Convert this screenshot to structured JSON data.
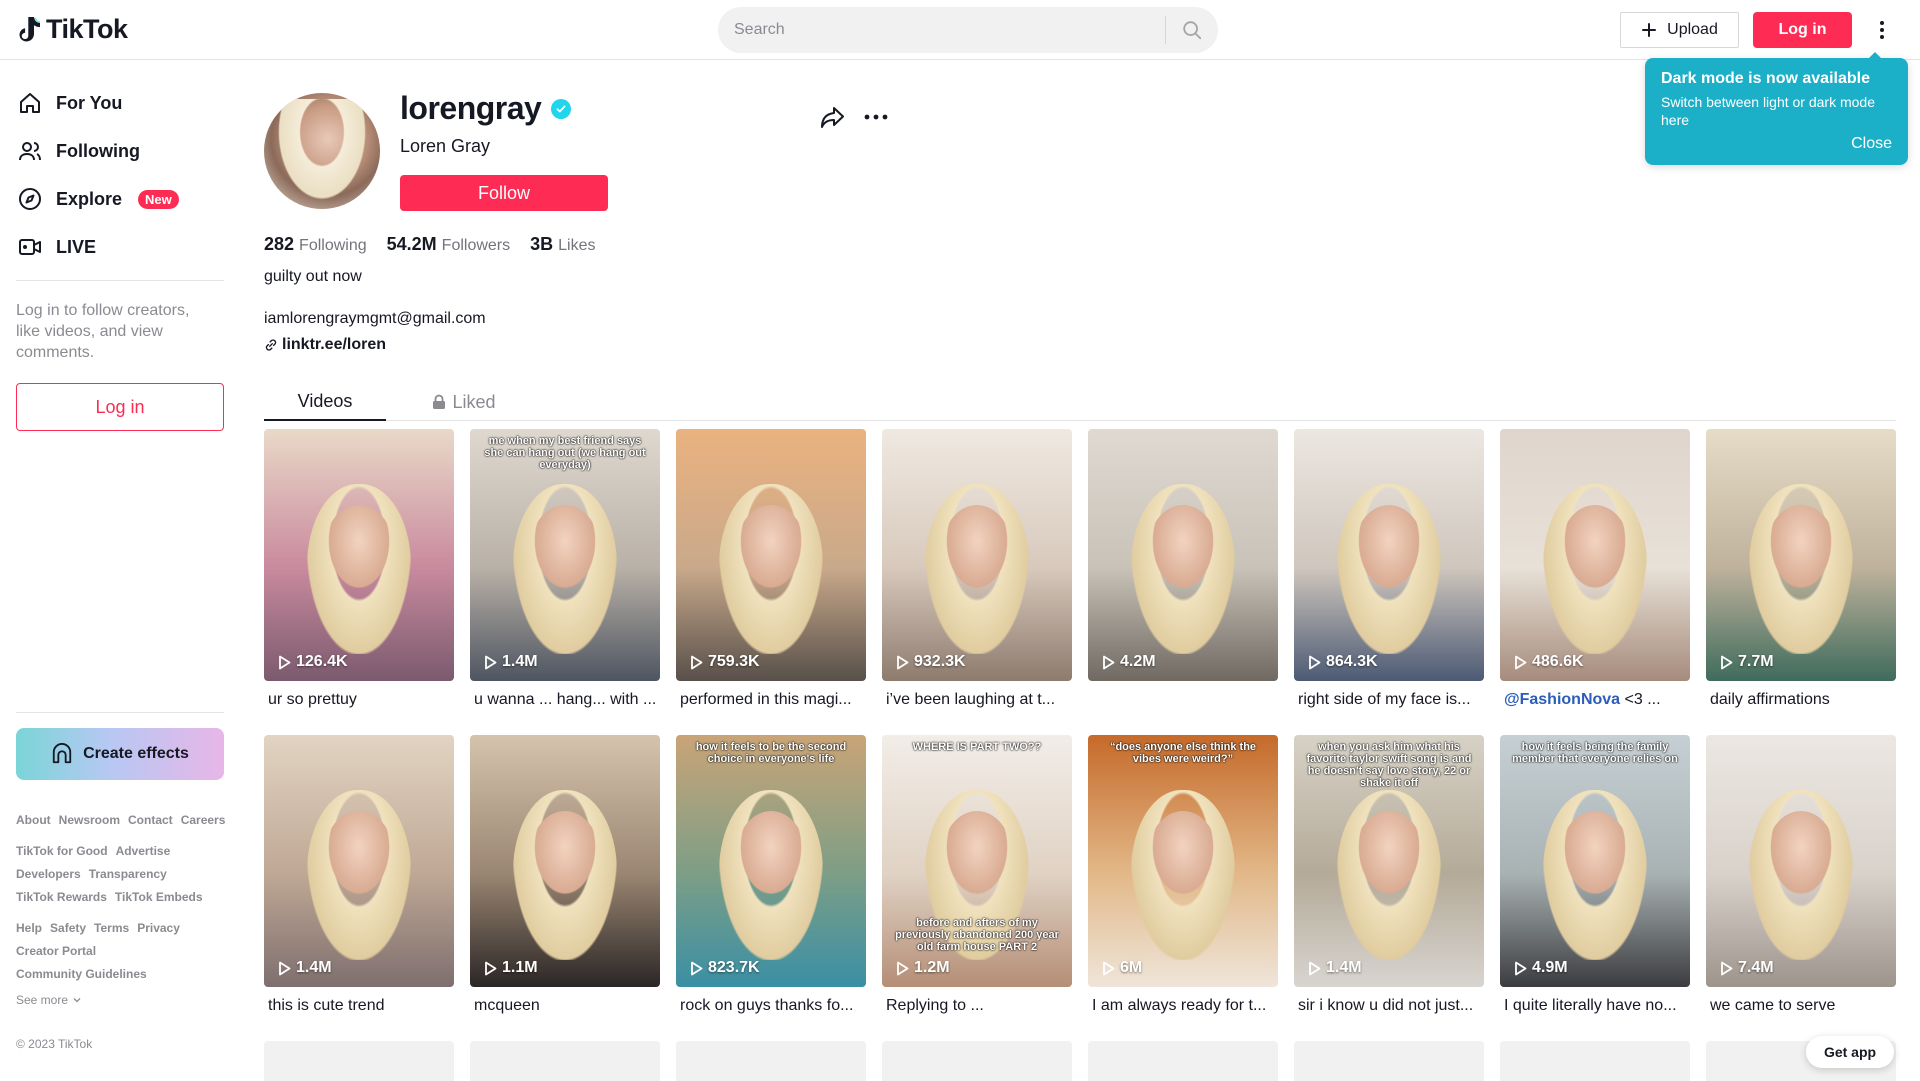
{
  "header": {
    "logo_text": "TikTok",
    "search_placeholder": "Search",
    "upload_label": "Upload",
    "login_label": "Log in"
  },
  "tooltip": {
    "title": "Dark mode is now available",
    "description": "Switch between light or dark mode here",
    "close_label": "Close"
  },
  "sidebar": {
    "nav": [
      {
        "label": "For You",
        "icon": "home-icon"
      },
      {
        "label": "Following",
        "icon": "following-icon"
      },
      {
        "label": "Explore",
        "icon": "compass-icon",
        "badge": "New"
      },
      {
        "label": "LIVE",
        "icon": "live-icon"
      }
    ],
    "login_prompt": "Log in to follow creators, like videos, and view comments.",
    "login_button": "Log in",
    "create_effects": "Create effects",
    "footer_rows": [
      [
        "About",
        "Newsroom",
        "Contact",
        "Careers"
      ],
      [
        "TikTok for Good",
        "Advertise"
      ],
      [
        "Developers",
        "Transparency"
      ],
      [
        "TikTok Rewards",
        "TikTok Embeds"
      ],
      [
        "Help",
        "Safety",
        "Terms",
        "Privacy"
      ],
      [
        "Creator Portal"
      ],
      [
        "Community Guidelines"
      ]
    ],
    "see_more": "See more",
    "copyright": "© 2023 TikTok"
  },
  "profile": {
    "username": "lorengray",
    "display_name": "Loren Gray",
    "follow_label": "Follow",
    "stats": {
      "following": {
        "value": "282",
        "label": "Following"
      },
      "followers": {
        "value": "54.2M",
        "label": "Followers"
      },
      "likes": {
        "value": "3B",
        "label": "Likes"
      }
    },
    "bio_line1": "guilty out now",
    "bio_line2": "iamlorengraymgmt@gmail.com",
    "link": "linktr.ee/loren"
  },
  "tabs": {
    "videos": "Videos",
    "liked": "Liked"
  },
  "videos": [
    {
      "views": "126.4K",
      "title": "ur so prettuy",
      "bg": [
        "#e9d9c8",
        "#c98a9e",
        "#7b5a6e"
      ],
      "overlay": ""
    },
    {
      "views": "1.4M",
      "title": "u wanna ... hang... with ...",
      "bg": [
        "#dfd8cf",
        "#b9b1a7",
        "#4e5561"
      ],
      "overlay": "me when my best friend says she can hang out (we hang out everyday)"
    },
    {
      "views": "759.3K",
      "title": "performed in this magi...",
      "bg": [
        "#eab27f",
        "#c9a98b",
        "#58504a"
      ],
      "overlay": ""
    },
    {
      "views": "932.3K",
      "title": "i’ve been laughing at t...",
      "bg": [
        "#efe9e1",
        "#d8c9bc",
        "#8d7b6e"
      ],
      "overlay": ""
    },
    {
      "views": "4.2M",
      "title": "",
      "bg": [
        "#dfd9d2",
        "#c9c2b8",
        "#6f6962"
      ],
      "overlay": ""
    },
    {
      "views": "864.3K",
      "title": "right side of my face is...",
      "bg": [
        "#ece7e1",
        "#cfc6bd",
        "#4c5a74"
      ],
      "overlay": ""
    },
    {
      "views": "486.6K",
      "title": "<3 ...",
      "mention": "@FashionNova",
      "bg": [
        "#dfd5cc",
        "#e8e1d8",
        "#a68b7c"
      ],
      "overlay": ""
    },
    {
      "views": "7.7M",
      "title": "daily affirmations",
      "bg": [
        "#e6dcc7",
        "#bfb29c",
        "#3f6b5c"
      ],
      "overlay": ""
    },
    {
      "views": "1.4M",
      "title": "this is cute trend",
      "bg": [
        "#e2d4c2",
        "#bfa895",
        "#7e6f6e"
      ],
      "overlay": ""
    },
    {
      "views": "1.1M",
      "title": "mcqueen",
      "bg": [
        "#d6c3ad",
        "#9a8672",
        "#2b2626"
      ],
      "overlay": ""
    },
    {
      "views": "823.7K",
      "title": "rock on guys thanks fo...",
      "bg": [
        "#c9a477",
        "#7d9e86",
        "#3a8fa5"
      ],
      "overlay": "how it feels to be the second choice in everyone's life"
    },
    {
      "views": "1.2M",
      "title": "Replying to ...",
      "bg": [
        "#f2ede8",
        "#e0d2c4",
        "#b58e76"
      ],
      "overlay": "WHERE IS PART TWO??",
      "overlay_bottom": "before and afters of my previously abandoned 200 year old farm house PART 2"
    },
    {
      "views": "6M",
      "title": "I am always ready for t...",
      "bg": [
        "#c56a2a",
        "#e2b888",
        "#efe5da"
      ],
      "overlay": "“does anyone else think the vibes were weird?”"
    },
    {
      "views": "1.4M",
      "title": "sir i know u did not just...",
      "bg": [
        "#d7d2c6",
        "#b4aa98",
        "#d8d4d0"
      ],
      "overlay": "when you ask him what his favorite taylor swift song is and he doesn't say love story, 22 or shake it off"
    },
    {
      "views": "4.9M",
      "title": "I quite literally have no...",
      "bg": [
        "#c6d0d4",
        "#a9b2b3",
        "#3c3c40"
      ],
      "overlay": "how it feels being the family member that everyone relies on"
    },
    {
      "views": "7.4M",
      "title": "we came to serve",
      "bg": [
        "#ece7e2",
        "#d9d2cb",
        "#9d948c"
      ],
      "overlay": ""
    }
  ],
  "get_app": "Get app"
}
